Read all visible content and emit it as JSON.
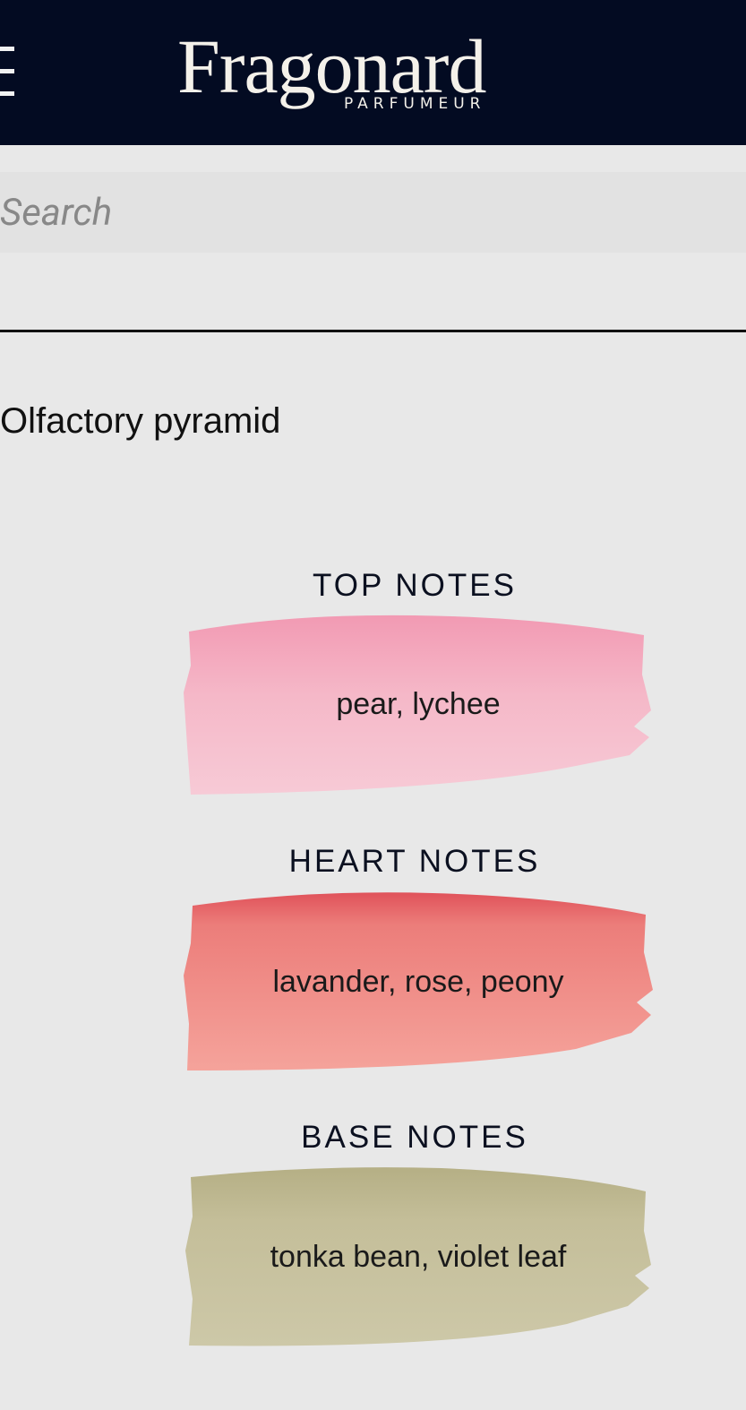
{
  "header": {
    "logo_name": "Fragonard",
    "logo_subtitle": "PARFUMEUR",
    "menu_icon": "hamburger-menu-icon",
    "background": "#030b22"
  },
  "search": {
    "placeholder": "Search",
    "value": ""
  },
  "pyramid": {
    "title": "Olfactory pyramid",
    "top": {
      "label": "TOP NOTES",
      "notes": "pear, lychee",
      "color": "#f4b3c4"
    },
    "heart": {
      "label": "HEART NOTES",
      "notes": "lavander, rose, peony",
      "color": "#ef8c86"
    },
    "base": {
      "label": "BASE NOTES",
      "notes": "tonka bean, violet leaf",
      "color": "#c8c3a0"
    }
  }
}
